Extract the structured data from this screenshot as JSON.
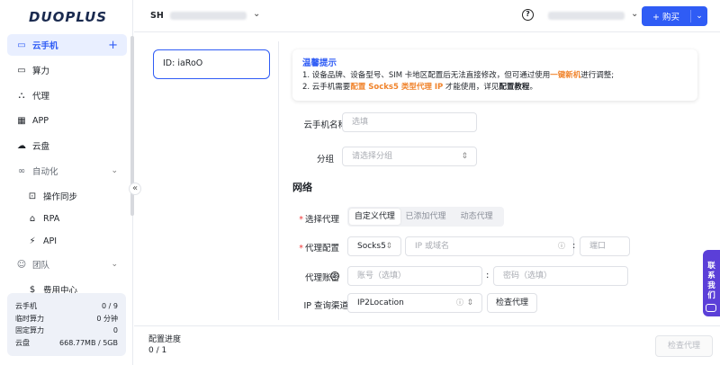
{
  "brand": {
    "logo_text": "DUOPLUS"
  },
  "sidebar": {
    "items": [
      {
        "label": "云手机",
        "icon": "phone-icon",
        "active": true
      },
      {
        "label": "算力",
        "icon": "monitor-icon"
      },
      {
        "label": "代理",
        "icon": "network-icon"
      },
      {
        "label": "APP",
        "icon": "grid-icon"
      },
      {
        "label": "云盘",
        "icon": "cloud-icon"
      }
    ],
    "automation": {
      "label": "自动化",
      "icon": "infinity-icon"
    },
    "automation_items": [
      {
        "label": "操作同步",
        "icon": "sync-icon"
      },
      {
        "label": "RPA",
        "icon": "robot-icon"
      },
      {
        "label": "API",
        "icon": "api-icon"
      }
    ],
    "team": {
      "label": "团队",
      "icon": "team-icon"
    },
    "team_items": [
      {
        "label": "费用中心",
        "icon": "dollar-icon"
      }
    ],
    "stats": [
      {
        "label": "云手机",
        "value": "0 / 9"
      },
      {
        "label": "临时算力",
        "value": "0 分钟"
      },
      {
        "label": "固定算力",
        "value": "0"
      },
      {
        "label": "云盘",
        "value": "668.77MB / 5GB"
      }
    ]
  },
  "header": {
    "region": "SH",
    "buy_label": "购买",
    "buy_prefix": "+"
  },
  "device": {
    "id_label": "ID: iaRoO"
  },
  "tip": {
    "title": "温馨提示",
    "line1_a": "1. 设备品牌、设备型号、SIM 卡地区配置后无法直接修改，但可通过使用",
    "line1_hl": "一键新机",
    "line1_b": "进行调整;",
    "line2_a": "2. 云手机需要",
    "line2_hl": "配置 Socks5 类型代理 IP",
    "line2_b": " 才能使用，详见",
    "line2_bold": "配置教程",
    "line2_c": "。"
  },
  "form": {
    "name_label": "云手机名称",
    "name_placeholder": "选填",
    "group_label": "分组",
    "group_placeholder": "请选择分组",
    "network_title": "网络",
    "proxy_select_label": "选择代理",
    "proxy_tabs": [
      "自定义代理",
      "已添加代理",
      "动态代理"
    ],
    "proxy_config_label": "代理配置",
    "proxy_type": "Socks5",
    "ip_placeholder": "IP 或域名",
    "port_placeholder": "端口",
    "account_label": "代理账密",
    "account_placeholder": "账号（选填）",
    "password_placeholder": "密码（选填）",
    "ip_channel_label": "IP 查询渠道",
    "ip_channel_value": "IP2Location",
    "check_proxy_label": "检查代理"
  },
  "footer": {
    "progress_label": "配置进度",
    "progress_value": "0 / 1",
    "check_button": "检查代理"
  },
  "contact": {
    "label_1": "联",
    "label_2": "系",
    "label_3": "我",
    "label_4": "们"
  },
  "colors": {
    "accent": "#2f5cf5",
    "highlight": "#f0832b",
    "contact": "#5b3fd8"
  }
}
